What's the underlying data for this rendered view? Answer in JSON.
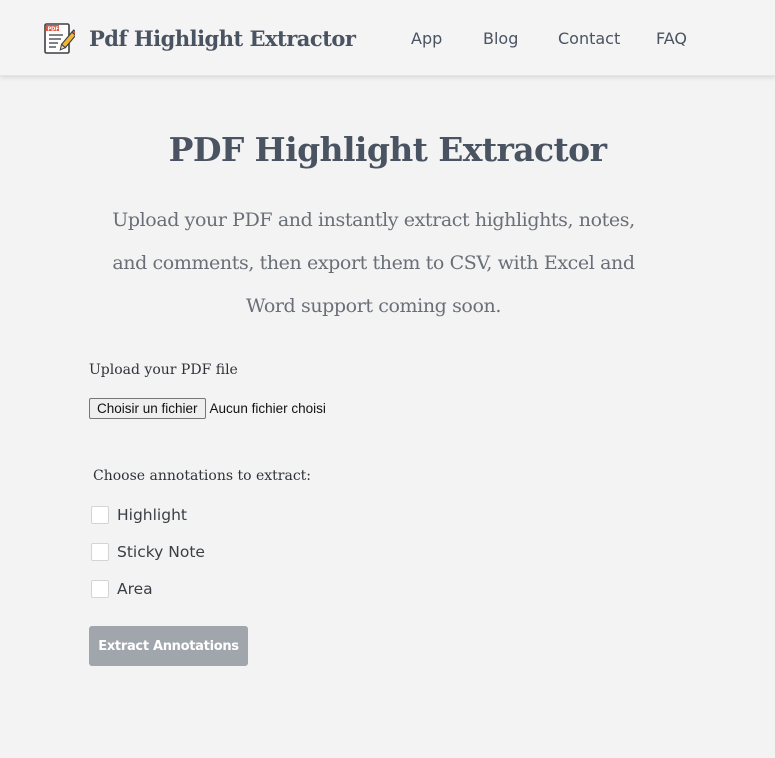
{
  "nav": {
    "brand": "Pdf Highlight Extractor",
    "brand_icon": "pdf-edit-icon",
    "links": [
      {
        "label": "App"
      },
      {
        "label": "Blog"
      },
      {
        "label": "Contact"
      },
      {
        "label": "FAQ"
      }
    ]
  },
  "hero": {
    "title": "PDF Highlight Extractor",
    "description": "Upload your PDF and instantly extract highlights, notes, and comments, then export them to CSV, with Excel and Word support coming soon."
  },
  "upload": {
    "label": "Upload your PDF file",
    "button_label": "Choisir un fichier",
    "status": "Aucun fichier choisi"
  },
  "annotations": {
    "heading": "Choose annotations to extract:",
    "options": [
      {
        "label": "Highlight",
        "checked": false
      },
      {
        "label": "Sticky Note",
        "checked": false
      },
      {
        "label": "Area",
        "checked": false
      }
    ]
  },
  "actions": {
    "extract_label": "Extract Annotations",
    "extract_disabled": true
  },
  "colors": {
    "page_background": "#f3f3f3",
    "text_primary": "#4a5361",
    "text_muted": "#6a6f77",
    "button_disabled": "#a1a6ac"
  }
}
